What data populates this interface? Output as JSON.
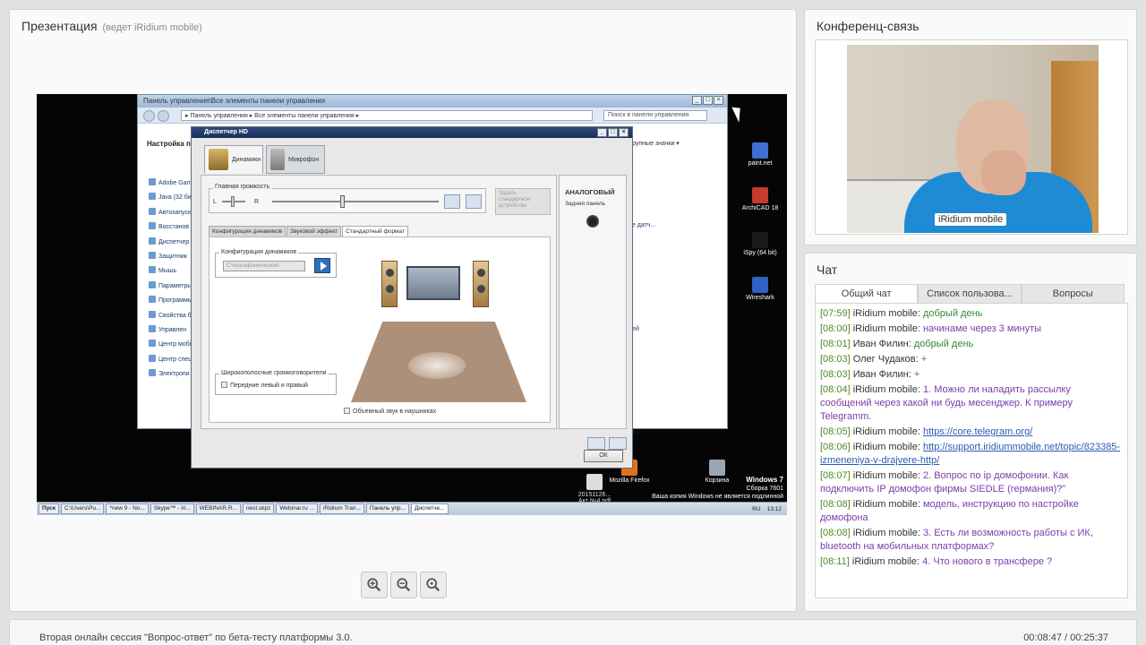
{
  "presentation": {
    "title": "Презентация",
    "subtitle": "(ведет iRidium mobile)",
    "screen": {
      "control_panel": {
        "title": "Панель управления\\Все элементы панели управления",
        "address": "▸ Панель управления ▸ Все элементы панели управления ▸",
        "search_placeholder": "Поиск в панели управления",
        "heading": "Настройка параме",
        "view_label": "Крупные значки ▾",
        "items": [
          "Adobe Gam",
          "Java (32 би",
          "Автозапуск",
          "Восстанов",
          "Диспетчер",
          "Защитник",
          "Мышь",
          "Параметры",
          "Программы",
          "Свойства б",
          "Управлен",
          "Центр мобі",
          "Центр спец",
          "Электропи"
        ],
        "right_text_1": "ие датч...",
        "right_text_2": "лей",
        "right_text_3": "зе -",
        "right_text_4": "ык"
      },
      "hd_manager": {
        "title": "Диспетчер HD",
        "tab_speakers": "Динамики",
        "tab_mic": "Микрофон",
        "volume_label": "Главная громкость",
        "left": "L",
        "right": "R",
        "device_select": "Задать стандартное устройство",
        "subtab_config": "Конфигурация динамиков",
        "subtab_effect": "Звуковой эффект",
        "subtab_format": "Стандартный формат",
        "config_label": "Конфигурация динамиков",
        "config_value": "Стереофонический",
        "wide_label": "Широкополосные громкоговорители",
        "front_lr": "Передние левый и правый",
        "surround": "Объемный звук в наушниках",
        "analog": "АНАЛОГОВЫЙ",
        "rear_panel": "Задняя панель",
        "ok": "ОК"
      },
      "desktop_icons": [
        {
          "label": "paint.net",
          "color": "#3f6fd0"
        },
        {
          "label": "ArchiCAD 18",
          "color": "#c43b2f"
        },
        {
          "label": "iSpy (64 bit)",
          "color": "#1a1a1a"
        },
        {
          "label": "Wireshark",
          "color": "#2f62c4"
        },
        {
          "label": "Mozilla Firefox",
          "color": "#e2721b"
        },
        {
          "label": "Корзина",
          "color": "#9aa6b2"
        }
      ],
      "pdf_label": "20151126...\nАкт №4.pdf",
      "windows_info": {
        "name": "Windows 7",
        "build": "Сборка 7601",
        "notice": "Ваша копия Windows не является подлинной"
      },
      "taskbar": {
        "start": "Пуск",
        "items": [
          "C:\\Users\\Pu...",
          "*new 9 - No...",
          "Skype™ - iri...",
          "WEBINAR.R...",
          "nest.skpz",
          "Webinar.ru ...",
          "iRidium Tran...",
          "Панель упр...",
          "Диспетче..."
        ],
        "lang": "RU",
        "clock": "13:12"
      }
    },
    "zoom_buttons": [
      "zoom-in",
      "zoom-out",
      "zoom-reset"
    ]
  },
  "conference": {
    "title": "Конференц-связь",
    "camera_label": "iRidium mobile"
  },
  "chat": {
    "title": "Чат",
    "tabs": [
      "Общий чат",
      "Список пользова...",
      "Вопросы"
    ],
    "messages": [
      {
        "time": "[07:59]",
        "author": "iRidium mobile:",
        "text": "добрый день",
        "style": "green"
      },
      {
        "time": "[08:00]",
        "author": "iRidium mobile:",
        "text": "начинаме через 3 минуты",
        "style": "purple"
      },
      {
        "time": "[08:01]",
        "author": "Иван Филин:",
        "text": "добрый день",
        "style": "green"
      },
      {
        "time": "[08:03]",
        "author": "Олег Чудаков:",
        "text": "+",
        "style": "green"
      },
      {
        "time": "[08:03]",
        "author": "Иван Филин:",
        "text": "+",
        "style": "green"
      },
      {
        "time": "[08:04]",
        "author": "iRidium mobile:",
        "text": "1. Можно ли наладить рассылку сообщений через какой ни будь месенджер. К примеру Telegramm.",
        "style": "purple"
      },
      {
        "time": "[08:05]",
        "author": "iRidium mobile:",
        "text": "https://core.telegram.org/",
        "style": "link"
      },
      {
        "time": "[08:06]",
        "author": "iRidium mobile:",
        "text": "http://support.iridiummobile.net/topic/823385-izmeneniya-v-drajvere-http/",
        "style": "link"
      },
      {
        "time": "[08:07]",
        "author": "iRidium mobile:",
        "text": "2. Вопрос по ip домофонии. Как подключить IP домофон фирмы SIEDLE (германия)?\"",
        "style": "purple"
      },
      {
        "time": "[08:08]",
        "author": "iRidium mobile:",
        "text": "модель, инструкцию по настройке домофона",
        "style": "purple"
      },
      {
        "time": "[08:08]",
        "author": "iRidium mobile:",
        "text": "3. Есть ли возможность работы с ИК, bluetooth на мобильных платформах?",
        "style": "purple"
      },
      {
        "time": "[08:11]",
        "author": "iRidium mobile:",
        "text": "4. Что нового в трансфере ?",
        "style": "purple"
      }
    ]
  },
  "footer": {
    "session_title": "Вторая онлайн сессия \"Вопрос-ответ\" по бета-тесту платформы 3.0.",
    "timer": "00:08:47 / 00:25:37"
  }
}
